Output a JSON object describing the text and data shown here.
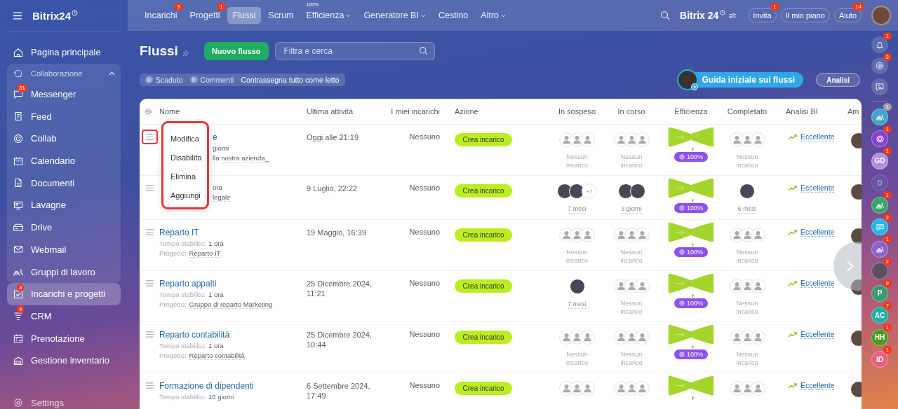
{
  "sidebar": {
    "logo": "Bitrix24",
    "top_items": [
      {
        "label": "Pagina principale",
        "selected": false
      }
    ],
    "group": {
      "label": "Collaborazione",
      "expanded": true,
      "items": [
        {
          "label": "Messenger",
          "badge": "31",
          "selected": false
        },
        {
          "label": "Feed",
          "selected": false
        },
        {
          "label": "Collab",
          "selected": false
        },
        {
          "label": "Calendario",
          "selected": false
        },
        {
          "label": "Documenti",
          "selected": false
        },
        {
          "label": "Lavagne",
          "selected": false
        },
        {
          "label": "Drive",
          "selected": false
        },
        {
          "label": "Webmail",
          "selected": false
        },
        {
          "label": "Gruppi di lavoro",
          "selected": false
        }
      ]
    },
    "bottom_items": [
      {
        "label": "Incarichi e progetti",
        "badge": "3",
        "selected": true
      },
      {
        "label": "CRM",
        "badge": "4",
        "selected": false
      },
      {
        "label": "Prenotazione",
        "selected": false
      },
      {
        "label": "Gestione inventario",
        "selected": false
      }
    ],
    "settings": "Settings"
  },
  "topbar": {
    "tabs": [
      {
        "label": "Incarichi",
        "badge": "3",
        "selected": false,
        "has_menu": false
      },
      {
        "label": "Progetti",
        "badge": "1",
        "selected": false,
        "has_menu": false
      },
      {
        "label": "Flussi",
        "selected": true,
        "has_menu": false
      },
      {
        "label": "Scrum",
        "selected": false,
        "has_menu": false
      },
      {
        "label": "Efficienza",
        "superscript": "100%",
        "selected": false,
        "has_menu": true
      },
      {
        "label": "Generatore BI",
        "selected": false,
        "has_menu": true
      },
      {
        "label": "Cestino",
        "selected": false,
        "has_menu": false
      },
      {
        "label": "Altro",
        "selected": false,
        "has_menu": true
      }
    ],
    "logo": "Bitrix 24",
    "buttons": [
      {
        "label": "Invita",
        "badge": "1"
      },
      {
        "label": "Il mio piano"
      },
      {
        "label": "Aiuto",
        "badge": "14"
      }
    ]
  },
  "page": {
    "title": "Flussi",
    "new_button": "Nuovo flusso",
    "search": {
      "placeholder": "Filtra e cerca"
    },
    "counters": [
      {
        "count": "0",
        "label": "Scaduto"
      },
      {
        "count": "0",
        "label": "Commenti"
      }
    ],
    "mark_read": "Contrassegna tutto come letto",
    "guide_button": "Guida iniziale sui flussi",
    "analysis_button": "Analisi"
  },
  "table": {
    "columns": [
      "Nome",
      "Ultima attività",
      "I miei incarichi",
      "Azione",
      "In sospeso",
      "In corso",
      "Efficienza",
      "Completato",
      "Analisi BI",
      "Am"
    ],
    "rows": [
      {
        "name": "e",
        "time": "giorni",
        "project": "lla nostra azienda_",
        "last": "Oggi alle 21:19",
        "mine": "Nessuno",
        "action": "Crea incarico",
        "menu_open": true,
        "pending": {
          "kind": "empty",
          "label": "Nessun incarico"
        },
        "in_progress": {
          "kind": "empty",
          "label": "Nessun incarico"
        },
        "efficiency": "100%",
        "done": {
          "kind": "empty",
          "label": "Nessun incarico"
        },
        "bi": "Eccellente"
      },
      {
        "time": "ora",
        "project": "legale",
        "last": "9 Luglio, 22:22",
        "mine": "Nessuno",
        "action": "Crea incarico",
        "menu_open": false,
        "pending": {
          "kind": "people",
          "photos": [
            {
              "kind": "photo"
            },
            {
              "kind": "photo"
            }
          ],
          "more": "+7",
          "label": "7 mesi"
        },
        "in_progress": {
          "kind": "people",
          "photos": [
            {
              "kind": "photo"
            },
            {
              "kind": "photo"
            }
          ],
          "label": "3 giorni"
        },
        "efficiency": "100%",
        "done": {
          "kind": "people",
          "photos": [
            {
              "kind": "photo"
            }
          ],
          "label": "6 mesi"
        },
        "bi": "Eccellente"
      },
      {
        "name": "Reparto IT",
        "time_label": "Tempo stabilito:",
        "time": "1 ora",
        "project_label": "Progetto:",
        "project": "Reparto IT",
        "last": "19 Maggio, 16:39",
        "mine": "Nessuno",
        "action": "Crea incarico",
        "menu_open": false,
        "pending": {
          "kind": "empty",
          "label": "Nessun incarico"
        },
        "in_progress": {
          "kind": "empty",
          "label": "Nessun incarico"
        },
        "efficiency": "100%",
        "done": {
          "kind": "empty",
          "label": "Nessun incarico"
        },
        "bi": "Eccellente"
      },
      {
        "name": "Reparto appalti",
        "time_label": "Tempo stabilito:",
        "time": "1 ora",
        "project_label": "Progetto:",
        "project": "Gruppo di reparto Marketing",
        "last": "25 Dicembre 2024, 11:21",
        "mine": "Nessuno",
        "action": "Crea incarico",
        "menu_open": false,
        "pending": {
          "kind": "people",
          "photos": [
            {
              "kind": "photo"
            }
          ],
          "label": "7 mesi"
        },
        "in_progress": {
          "kind": "empty",
          "label": "Nessun incarico"
        },
        "efficiency": "100%",
        "done": {
          "kind": "empty",
          "label": "Nessun incarico"
        },
        "bi": "Eccellente"
      },
      {
        "name": "Reparto contabilità",
        "time_label": "Tempo stabilito:",
        "time": "1 ora",
        "project_label": "Progetto:",
        "project": "Reparto contabilità",
        "last": "25 Dicembre 2024, 10:44",
        "mine": "Nessuno",
        "action": "Crea incarico",
        "menu_open": false,
        "pending": {
          "kind": "empty",
          "label": "Nessun incarico"
        },
        "in_progress": {
          "kind": "empty",
          "label": "Nessun incarico"
        },
        "efficiency": "100%",
        "done": {
          "kind": "empty",
          "label": "Nessun incarico"
        },
        "bi": "Eccellente"
      },
      {
        "name": "Formazione di dipendenti",
        "time_label": "Tempo stabilito:",
        "time": "10 giorni",
        "last": "6 Settembre 2024, 17:49",
        "mine": "Nessuno",
        "action": "Crea incarico",
        "menu_open": false,
        "pending": {
          "kind": "empty"
        },
        "in_progress": {
          "kind": "empty"
        },
        "done": {
          "kind": "empty"
        },
        "bi": "Eccellente"
      }
    ]
  },
  "row_menu": {
    "items": [
      "Modifica",
      "Disabilita",
      "Elimina",
      "Aggiungi"
    ]
  },
  "rail": {
    "top": [
      {
        "kind": "bell",
        "badge": "1"
      },
      {
        "kind": "spiral",
        "badge": "2"
      },
      {
        "kind": "chat"
      }
    ],
    "contacts": [
      {
        "kind": "group",
        "color": "#3fa6c8",
        "badge": "1",
        "badge_muted": true,
        "dimmed": false
      },
      {
        "kind": "spiral",
        "color": "#8a3fd6",
        "badge": "1",
        "badge_muted": false,
        "dimmed": false
      },
      {
        "kind": "initials",
        "initials": "GD",
        "color": "#b38be0",
        "badge": "1",
        "badge_muted": false,
        "dimmed": false
      },
      {
        "kind": "initials",
        "initials": "D",
        "color": "#6a5fb8",
        "dimmed": true
      },
      {
        "kind": "group",
        "color": "#3aa46a",
        "badge": "1",
        "badge_muted": false,
        "dimmed": false
      },
      {
        "kind": "chat",
        "color": "#22b8e8",
        "badge": "2",
        "badge_muted": false,
        "dimmed": false
      },
      {
        "kind": "group",
        "color": "#8a63d2",
        "badge": "1",
        "badge_muted": false,
        "dimmed": false
      },
      {
        "kind": "photo",
        "color": "#5a5060",
        "badge": "2",
        "badge_muted": false,
        "dimmed": false
      },
      {
        "kind": "initials",
        "initials": "P",
        "color": "#3a9a6e",
        "badge": "9",
        "badge_muted": false,
        "dimmed": false
      },
      {
        "kind": "initials",
        "initials": "AC",
        "color": "#1fb1a6",
        "badge": "7",
        "badge_muted": false,
        "dimmed": false
      },
      {
        "kind": "initials",
        "initials": "HH",
        "color": "#4c9a1c",
        "badge": "1",
        "badge_muted": false,
        "dimmed": false
      },
      {
        "kind": "initials",
        "initials": "ID",
        "color": "#e8607a",
        "badge": "1",
        "badge_muted": false,
        "dimmed": false
      }
    ]
  }
}
